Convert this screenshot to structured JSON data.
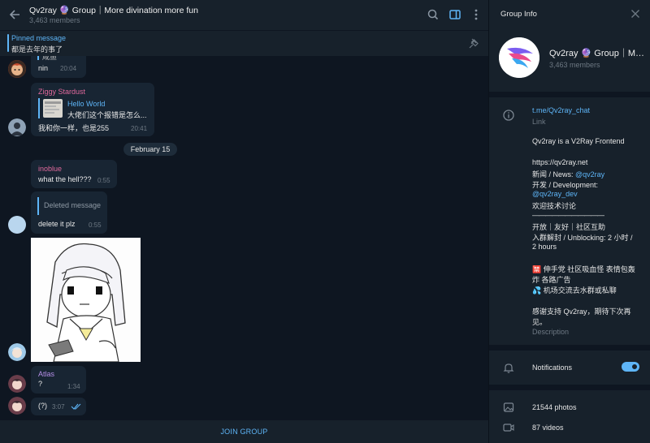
{
  "chat": {
    "title": "Qv2ray 🔮 Group｜More divination more fun",
    "members": "3,463 members",
    "pinned": {
      "label": "Pinned message",
      "text": "都是去年的事了"
    },
    "messages": {
      "m1": {
        "quote": "咸鱼",
        "text": "nin",
        "time": "20:04"
      },
      "m2": {
        "sender": "Ziggy Stardust",
        "reply_title": "Hello World",
        "reply_text": "大佬们这个报错是怎么...",
        "text": "我和你一样，也是255",
        "time": "20:41"
      },
      "date_sep": "February 15",
      "m3": {
        "sender": "inoblue",
        "text": "what the hell???",
        "time": "0:55"
      },
      "m4": {
        "deleted": "Deleted message",
        "text": "delete it plz",
        "time": "0:55"
      },
      "m5": {
        "sender": "Atlas",
        "text": "?",
        "time": "1:34"
      },
      "m6": {
        "text": "(?)",
        "time": "3:07"
      }
    },
    "join_label": "JOIN GROUP"
  },
  "info": {
    "header": "Group Info",
    "name": "Qv2ray 🔮 Group｜More divination more fun",
    "members": "3,463 members",
    "link": "t.me/Qv2ray_chat",
    "link_label": "Link",
    "desc": {
      "l1": "Qv2ray is a V2Ray Frontend",
      "l2": "https://qv2ray.net",
      "l3a": "新闻 / News: ",
      "l3b": "@qv2ray",
      "l4": "开发 / Development:",
      "l5": "@qv2ray_dev",
      "l6": "欢迎技术讨论",
      "l7": "———————————",
      "l8": "开放｜友好｜社区互助",
      "l9": "入群解封 / Unblocking: 2 小时 /",
      "l10": "2 hours",
      "l11": "🈲 伸手党 社区吸血怪 表情包轰",
      "l12": "炸 各路广告",
      "l13": "💦 机场交流去水群或私聊",
      "l14": "感谢支持 Qv2ray，期待下次再",
      "l15": "见。"
    },
    "desc_label": "Description",
    "notifications_label": "Notifications",
    "notifications_on": true,
    "photos": "21544 photos",
    "videos": "87 videos"
  },
  "colors": {
    "accent": "#5eb5f7",
    "bg": "#0e1621",
    "panel": "#17212b",
    "bubble": "#182533"
  }
}
